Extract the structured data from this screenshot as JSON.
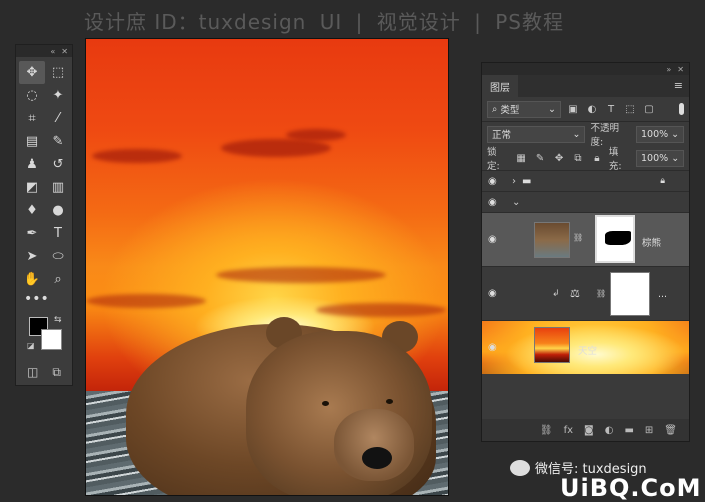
{
  "watermark": {
    "author": "设计庶 ID：tuxdesign",
    "cat_ui": "UI",
    "sep1": "|",
    "cat_visual": "视觉设计",
    "sep2": "|",
    "cat_ps": "PS教程"
  },
  "toolbox": {
    "tools": [
      {
        "name": "move-tool",
        "glyph": "✥"
      },
      {
        "name": "marquee-tool",
        "glyph": "⬚"
      },
      {
        "name": "lasso-tool",
        "glyph": "◌"
      },
      {
        "name": "magic-wand-tool",
        "glyph": "✦"
      },
      {
        "name": "crop-tool",
        "glyph": "⌗"
      },
      {
        "name": "eyedropper-tool",
        "glyph": "⁄"
      },
      {
        "name": "healing-tool",
        "glyph": "▤"
      },
      {
        "name": "brush-tool",
        "glyph": "✎"
      },
      {
        "name": "stamp-tool",
        "glyph": "♟"
      },
      {
        "name": "history-brush-tool",
        "glyph": "↺"
      },
      {
        "name": "eraser-tool",
        "glyph": "◩"
      },
      {
        "name": "gradient-tool",
        "glyph": "▥"
      },
      {
        "name": "blur-tool",
        "glyph": "♦"
      },
      {
        "name": "dodge-tool",
        "glyph": "●"
      },
      {
        "name": "pen-tool",
        "glyph": "✒"
      },
      {
        "name": "type-tool",
        "glyph": "T"
      },
      {
        "name": "path-select-tool",
        "glyph": "➤"
      },
      {
        "name": "shape-tool",
        "glyph": "⬭"
      },
      {
        "name": "hand-tool",
        "glyph": "✋"
      },
      {
        "name": "zoom-tool",
        "glyph": "⌕"
      }
    ],
    "more": "•••",
    "swap": "⇆",
    "reset": "◪",
    "quick_mask": "◫",
    "screen_mode": "⧉",
    "colors": {
      "foreground": "#000000",
      "background": "#ffffff"
    }
  },
  "layers_panel": {
    "tab_label": "图层",
    "menu_glyph": "≡",
    "filter_kind": "类型",
    "blend_mode": "正常",
    "opacity_label": "不透明度:",
    "opacity_value": "100%",
    "lock_label": "锁定:",
    "fill_label": "填充:",
    "fill_value": "100%",
    "layers": [
      {
        "type": "folder",
        "name": ""
      },
      {
        "type": "group",
        "name": ""
      },
      {
        "type": "bear",
        "name": "棕熊"
      },
      {
        "type": "levels",
        "name": ""
      },
      {
        "type": "sky",
        "name": "天空"
      }
    ],
    "more": "..."
  },
  "wechat_label": "微信号: tuxdesign",
  "brand": "UiBQ.CoM"
}
